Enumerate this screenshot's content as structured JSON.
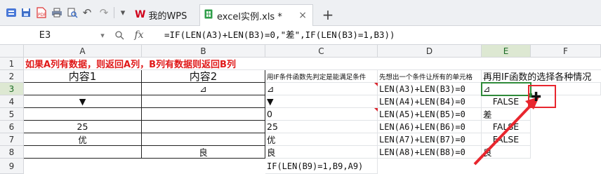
{
  "toolbar": {
    "icons": [
      "app-logo-icon",
      "save-icon",
      "export-pdf-icon",
      "print-icon",
      "print-preview-icon",
      "undo-icon",
      "redo-icon",
      "dropdown-icon"
    ],
    "undo_glyph": "↶",
    "redo_glyph": "↷",
    "dropdown_glyph": "▾"
  },
  "tabs": [
    {
      "label": "我的WPS",
      "icon": "wps-logo-icon",
      "active": false
    },
    {
      "label": "excel实例.xls *",
      "icon": "spreadsheet-icon",
      "active": true
    }
  ],
  "tab_close": "×",
  "new_tab": "+",
  "formula_bar": {
    "name_box": "E3",
    "fx": "fx",
    "formula": "=IF(LEN(A3)+LEN(B3)=0,\"差\",IF(LEN(B3)=1,B3))"
  },
  "columns": [
    "A",
    "B",
    "C",
    "D",
    "E",
    "F"
  ],
  "rows": [
    "1",
    "2",
    "3",
    "4",
    "5",
    "6",
    "7",
    "8",
    "9"
  ],
  "cells": {
    "A1": "如果A列有数据，则返回A列，B列有数据则返回B列",
    "A2": "内容1",
    "B2": "内容2",
    "C2": "用IF条件函数先判定是能满足条件",
    "D2": "先想出一个条件让所有的单元格",
    "E2": "再用IF函数的选择各种情况",
    "B3": "⊿",
    "C3": "⊿",
    "D3": "LEN(A3)+LEN(B3)=0",
    "E3": "⊿",
    "A4": "▼",
    "C4": "▼",
    "D4": "LEN(A4)+LEN(B4)=0",
    "E4": "FALSE",
    "C5": "0",
    "D5": "LEN(A5)+LEN(B5)=0",
    "E5": "差",
    "A6": "25",
    "C6": "25",
    "D6": "LEN(A6)+LEN(B6)=0",
    "E6": "FALSE",
    "A7": "优",
    "C7": "优",
    "D7": "LEN(A7)+LEN(B7)=0",
    "E7": "FALSE",
    "B8": "良",
    "C8": "良",
    "D8": "LEN(A8)+LEN(B8)=0",
    "E8": "良",
    "C9": "IF(LEN(B9)=1,B9,A9)"
  },
  "selected_cell": "E3",
  "colors": {
    "accent_red": "#e8262e",
    "selection_green": "#2f8a3a",
    "header_bg": "#f3f4f6"
  }
}
